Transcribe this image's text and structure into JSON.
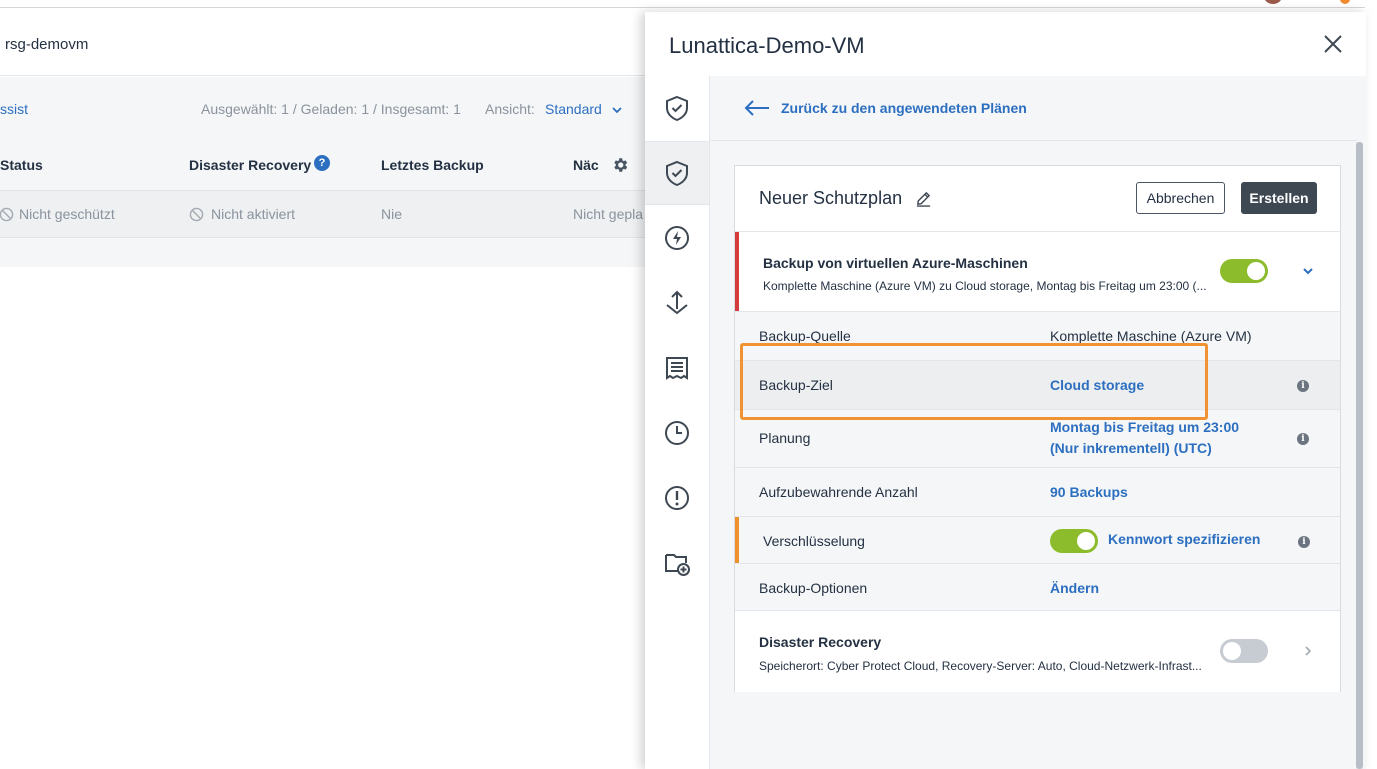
{
  "left": {
    "title": "rsg-demovm",
    "assist_link": "ssist",
    "selection_count": "Ausgewählt: 1 / Geladen: 1 / Insgesamt: 1",
    "view_label": "Ansicht:",
    "view_value": "Standard",
    "columns": [
      "Status",
      "Disaster Recovery",
      "Letztes Backup",
      "Näc"
    ],
    "help_glyph": "?",
    "row": {
      "status": "Nicht geschützt",
      "disaster_recovery": "Nicht aktiviert",
      "last_backup": "Nie",
      "next": "Nicht gepla"
    }
  },
  "panel": {
    "title": "Lunattica-Demo-VM",
    "back_link": "Zurück zu den angewendeten Plänen",
    "rail_icons": [
      "shield-check-icon",
      "shield-check-icon",
      "lightning-icon",
      "upload-arrow-icon",
      "receipt-icon",
      "clock-icon",
      "alert-icon",
      "folder-add-icon"
    ],
    "card": {
      "title": "Neuer Schutzplan",
      "cancel_label": "Abbrechen",
      "create_label": "Erstellen",
      "module": {
        "title": "Backup von virtuellen Azure-Maschinen",
        "subtitle": "Komplette Maschine (Azure VM) zu Cloud storage, Montag bis Freitag um 23:00 (...",
        "enabled": true
      },
      "rows": {
        "source_label": "Backup-Quelle",
        "source_value": "Komplette Maschine (Azure VM)",
        "target_label": "Backup-Ziel",
        "target_value": "Cloud storage",
        "schedule_label": "Planung",
        "schedule_value_line1": "Montag bis Freitag um 23:00",
        "schedule_value_line2": "(Nur inkrementell) (UTC)",
        "retention_label": "Aufzubewahrende Anzahl",
        "retention_value": "90 Backups",
        "encryption_label": "Verschlüsselung",
        "encryption_value": "Kennwort spezifizieren",
        "encryption_enabled": true,
        "options_label": "Backup-Optionen",
        "options_value": "Ändern"
      },
      "info_glyph": "i",
      "disaster_recovery": {
        "title": "Disaster Recovery",
        "subtitle": "Speicherort: Cyber Protect Cloud, Recovery-Server: Auto, Cloud-Netzwerk-Infrast...",
        "enabled": false
      }
    }
  },
  "colors": {
    "accent": "#2c6fc0",
    "toggle_on": "#8cbc2b",
    "annotation": "#f29333",
    "module_bar": "#d63b3b"
  }
}
